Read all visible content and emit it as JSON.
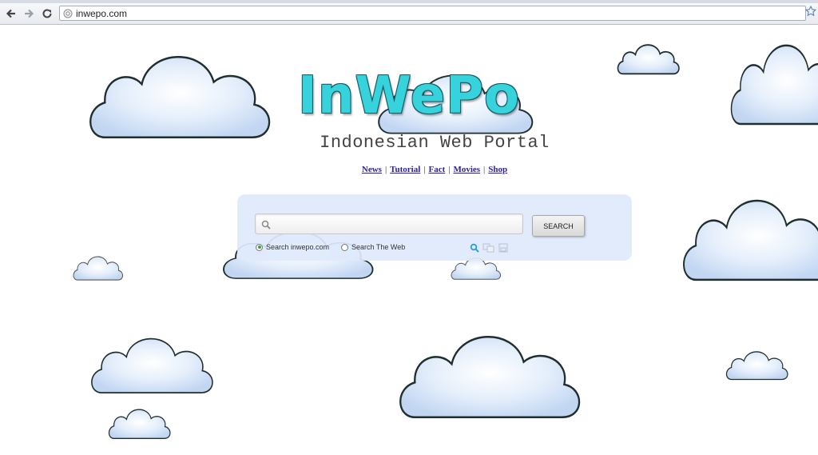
{
  "browser": {
    "url": "inwepo.com",
    "back_icon": "back-arrow-icon",
    "forward_icon": "forward-arrow-icon",
    "reload_icon": "reload-icon",
    "page_icon": "globe-icon",
    "bookmark_icon": "star-icon"
  },
  "header": {
    "logo_text": "InWePo",
    "tagline": "Indonesian Web Portal"
  },
  "nav": {
    "links": [
      "News",
      "Tutorial",
      "Fact",
      "Movies",
      "Shop"
    ],
    "separator": "|"
  },
  "search": {
    "input_value": "",
    "button_label": "SEARCH",
    "options": [
      "Search inwepo.com",
      "Search The Web"
    ],
    "selected_option": "Search inwepo.com"
  },
  "colors": {
    "logo": "#37d3dd",
    "link": "#2a1fa6",
    "panel": "#dee9fc"
  }
}
